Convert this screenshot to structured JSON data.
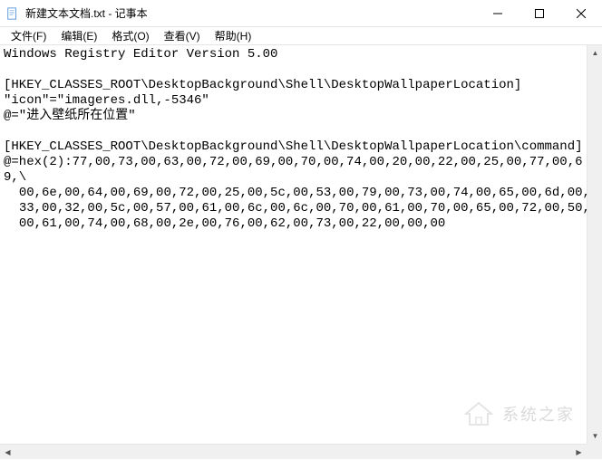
{
  "window": {
    "title": "新建文本文档.txt - 记事本"
  },
  "menu": {
    "file": "文件(F)",
    "edit": "编辑(E)",
    "format": "格式(O)",
    "view": "查看(V)",
    "help": "帮助(H)"
  },
  "content": {
    "text": "Windows Registry Editor Version 5.00\n\n[HKEY_CLASSES_ROOT\\DesktopBackground\\Shell\\DesktopWallpaperLocation]\n\"icon\"=\"imageres.dll,-5346\"\n@=\"进入壁纸所在位置\"\n\n[HKEY_CLASSES_ROOT\\DesktopBackground\\Shell\\DesktopWallpaperLocation\\command]\n@=hex(2):77,00,73,00,63,00,72,00,69,00,70,00,74,00,20,00,22,00,25,00,77,00,69,\\\n  00,6e,00,64,00,69,00,72,00,25,00,5c,00,53,00,79,00,73,00,74,00,65,00,6d,00,\\\n  33,00,32,00,5c,00,57,00,61,00,6c,00,6c,00,70,00,61,00,70,00,65,00,72,00,50,\\\n  00,61,00,74,00,68,00,2e,00,76,00,62,00,73,00,22,00,00,00"
  },
  "watermark": {
    "text": "系统之家"
  }
}
